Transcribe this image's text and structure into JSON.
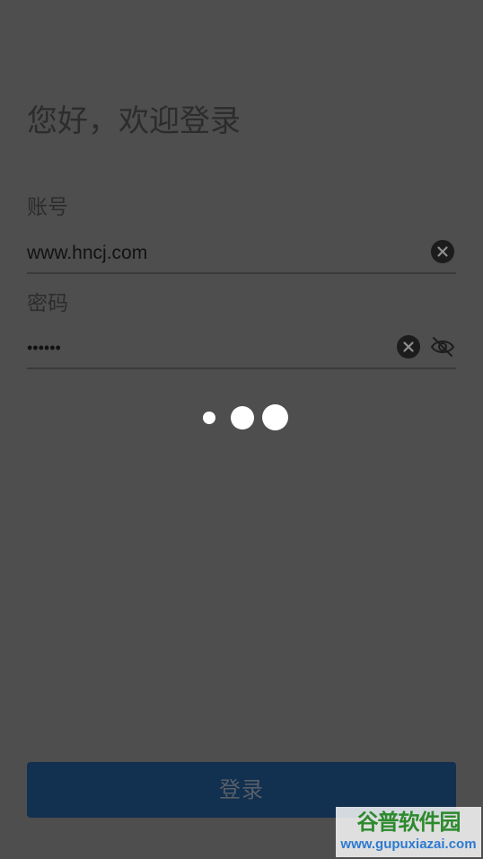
{
  "login": {
    "welcome_title": "您好，欢迎登录",
    "account": {
      "label": "账号",
      "value": "www.hncj.com"
    },
    "password": {
      "label": "密码",
      "value": "••••••"
    },
    "submit_label": "登录"
  },
  "icons": {
    "clear": "clear-circle-icon",
    "visibility": "eye-off-icon",
    "loading": "loading-dots-icon"
  },
  "colors": {
    "overlay_background": "#4e4e4e",
    "button_background": "#12304f",
    "loading_dots": "#ffffff"
  },
  "watermark": {
    "title": "谷普软件园",
    "url": "www.gupuxiazai.com"
  }
}
